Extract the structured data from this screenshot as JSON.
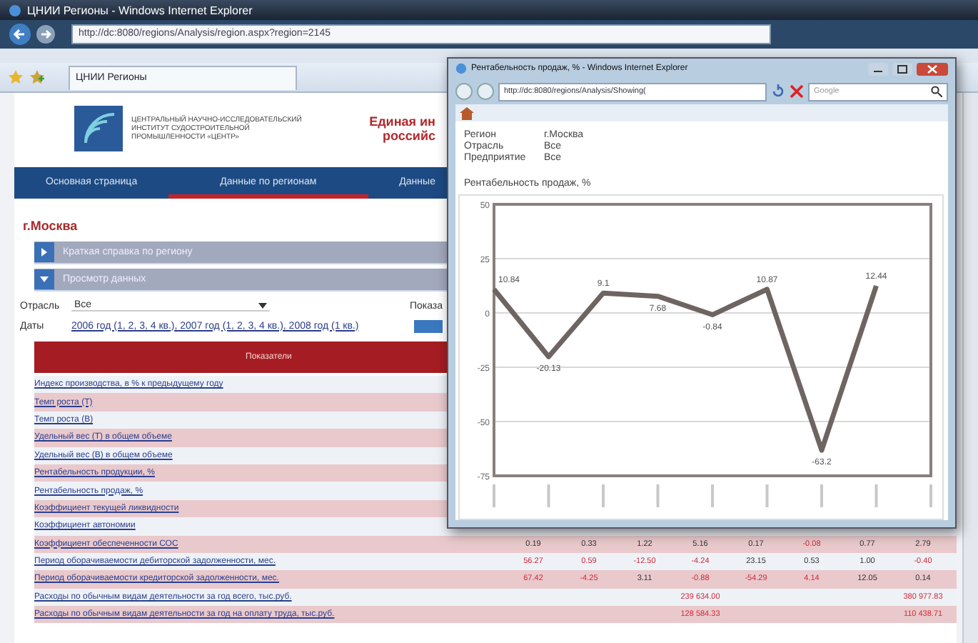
{
  "browser": {
    "title": "ЦНИИ Регионы - Windows Internet Explorer",
    "address": "http://dc:8080/regions/Analysis/region.aspx?region=2145",
    "tab": "ЦНИИ Регионы"
  },
  "site": {
    "logo_text": "ЦЕНТРАЛЬНЫЙ НАУЧНО-ИССЛЕДОВАТЕЛЬСКИЙ ИНСТИТУТ СУДОСТРОИТЕЛЬНОЙ ПРОМЫШЛЕННОСТИ «ЦЕНТР»",
    "header_lines": [
      "Единая ин",
      "российс"
    ]
  },
  "nav": [
    {
      "label": "Основная страница",
      "selected": false
    },
    {
      "label": "Данные по регионам",
      "selected": true
    },
    {
      "label": "Данные",
      "selected": false
    }
  ],
  "region_title": "г.Москва",
  "panels": [
    {
      "label": "Краткая справка по региону",
      "expanded": false
    },
    {
      "label": "Просмотр данных",
      "expanded": true
    }
  ],
  "filters": {
    "industry_label": "Отрасль",
    "industry_value": "Все",
    "indicator_label": "Показа",
    "dates_label": "Даты",
    "dates_value": "2006 год (1, 2, 3, 4 кв.), 2007 год (1, 2, 3, 4 кв.), 2008 год (1 кв.)"
  },
  "table": {
    "header": "Показатели",
    "rows": [
      {
        "label": "Индекс производства, в % к предыдущему году"
      },
      {
        "label": "Темп роста (Т)"
      },
      {
        "label": "Темп роста (В)"
      },
      {
        "label": "Удельный вес (Т) в общем объеме"
      },
      {
        "label": "Удельный вес (В) в общем объеме"
      },
      {
        "label": "Рентабельность продукции, %"
      },
      {
        "label": "Рентабельность продаж, %"
      },
      {
        "label": "Коэффициент текущей ликвидности"
      },
      {
        "label": "Коэффициент автономии"
      },
      {
        "label": "Коэффициент обеспеченности СОС",
        "cells": [
          {
            "text": "0.19",
            "flagged": false
          },
          {
            "text": "0.33",
            "flagged": false
          },
          {
            "text": "1.22",
            "flagged": false
          },
          {
            "text": "5.16",
            "flagged": false
          },
          {
            "text": "0.17",
            "flagged": false
          },
          {
            "text": "-0.08",
            "flagged": true
          },
          {
            "text": "0.77",
            "flagged": false
          },
          {
            "text": "2.79",
            "flagged": false
          }
        ]
      },
      {
        "label": "Период оборачиваемости дебиторской задолженности, мес.",
        "cells": [
          {
            "text": "56.27",
            "flagged": true
          },
          {
            "text": "0.59",
            "flagged": true
          },
          {
            "text": "-12.50",
            "flagged": true
          },
          {
            "text": "-4.24",
            "flagged": true
          },
          {
            "text": "23.15",
            "flagged": false
          },
          {
            "text": "0.53",
            "flagged": false
          },
          {
            "text": "1.00",
            "flagged": false
          },
          {
            "text": "-0.40",
            "flagged": true
          }
        ]
      },
      {
        "label": "Период оборачиваемости кредиторской задолженности, мес.",
        "cells": [
          {
            "text": "67.42",
            "flagged": true
          },
          {
            "text": "-4.25",
            "flagged": true
          },
          {
            "text": "3.11",
            "flagged": false
          },
          {
            "text": "-0.88",
            "flagged": true
          },
          {
            "text": "-54.29",
            "flagged": true
          },
          {
            "text": "4.14",
            "flagged": true
          },
          {
            "text": "12.05",
            "flagged": false
          },
          {
            "text": "0.14",
            "flagged": false
          }
        ]
      },
      {
        "label": "Расходы по обычным видам деятельности за год всего, тыс.руб.",
        "cells": [
          null,
          null,
          null,
          {
            "text": "239 634.00",
            "flagged": true
          },
          null,
          null,
          null,
          {
            "text": "380 977.83",
            "flagged": true
          }
        ]
      },
      {
        "label": "Расходы по обычным видам деятельности за год на оплату труда, тыс.руб.",
        "cells": [
          null,
          null,
          null,
          {
            "text": "128 584.33",
            "flagged": true
          },
          null,
          null,
          null,
          {
            "text": "110 438.71",
            "flagged": true
          }
        ]
      }
    ]
  },
  "popup": {
    "title": "Рентабельность продаж, % - Windows Internet Explorer",
    "address": "http://dc:8080/regions/Analysis/Showing(",
    "search_placeholder": "Google",
    "info": [
      {
        "label": "Регион",
        "value": "г.Москва"
      },
      {
        "label": "Отрасль",
        "value": "Все"
      },
      {
        "label": "Предприятие",
        "value": "Все"
      }
    ],
    "chart_title": "Рентабельность продаж, %",
    "chart_data": {
      "type": "line",
      "series": [
        {
          "color": "#6e6462",
          "values": [
            10.84,
            -20.13,
            9.1,
            7.68,
            -0.84,
            10.87,
            -63.2,
            12.44,
            null
          ]
        }
      ],
      "ylim": [
        -75,
        50
      ],
      "yticks": [
        50,
        25,
        0,
        -25,
        -50,
        -75
      ],
      "grid": true,
      "data_labels": true
    }
  }
}
